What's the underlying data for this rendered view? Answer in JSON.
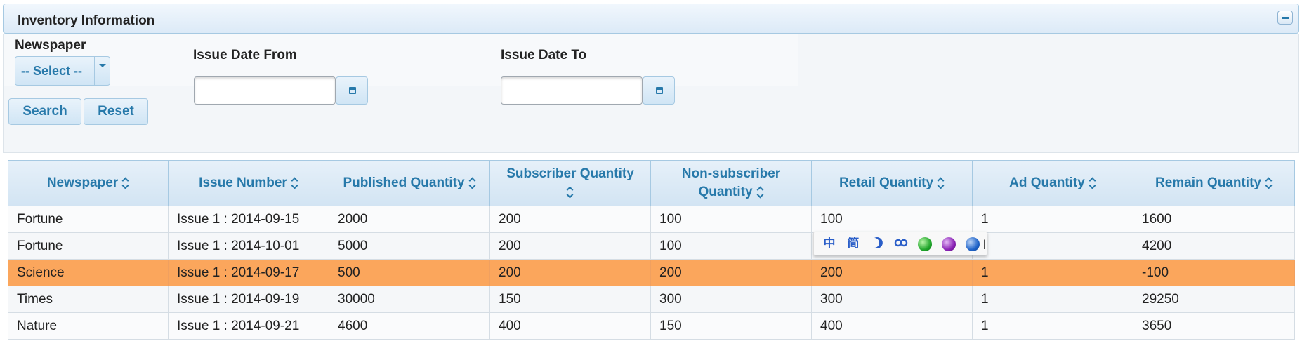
{
  "panel": {
    "title": "Inventory Information"
  },
  "filters": {
    "newspaper_label": "Newspaper",
    "newspaper_selected": "-- Select --",
    "date_from_label": "Issue Date From",
    "date_from_value": "",
    "date_to_label": "Issue Date To",
    "date_to_value": "",
    "search_label": "Search",
    "reset_label": "Reset"
  },
  "table": {
    "headers": [
      "Newspaper",
      "Issue Number",
      "Published Quantity",
      "Subscriber Quantity",
      "Non-subscriber Quantity",
      "Retail Quantity",
      "Ad Quantity",
      "Remain Quantity"
    ],
    "rows": [
      [
        "Fortune",
        "Issue 1 : 2014-09-15",
        "2000",
        "200",
        "100",
        "100",
        "1",
        "1600"
      ],
      [
        "Fortune",
        "Issue 1 : 2014-10-01",
        "5000",
        "200",
        "100",
        "",
        "",
        "4200"
      ],
      [
        "Science",
        "Issue 1 : 2014-09-17",
        "500",
        "200",
        "200",
        "200",
        "1",
        "-100"
      ],
      [
        "Times",
        "Issue 1 : 2014-09-19",
        "30000",
        "150",
        "300",
        "300",
        "1",
        "29250"
      ],
      [
        "Nature",
        "Issue 1 : 2014-09-21",
        "4600",
        "400",
        "150",
        "400",
        "1",
        "3650"
      ]
    ],
    "highlight_color": "#fba65c"
  },
  "ime_toolbar": {
    "chinese_label": "中",
    "simplified_label": "简",
    "partial_char": "l",
    "dot_colors": [
      "#1fa52a",
      "#8a22b5",
      "#1e63c9"
    ]
  }
}
